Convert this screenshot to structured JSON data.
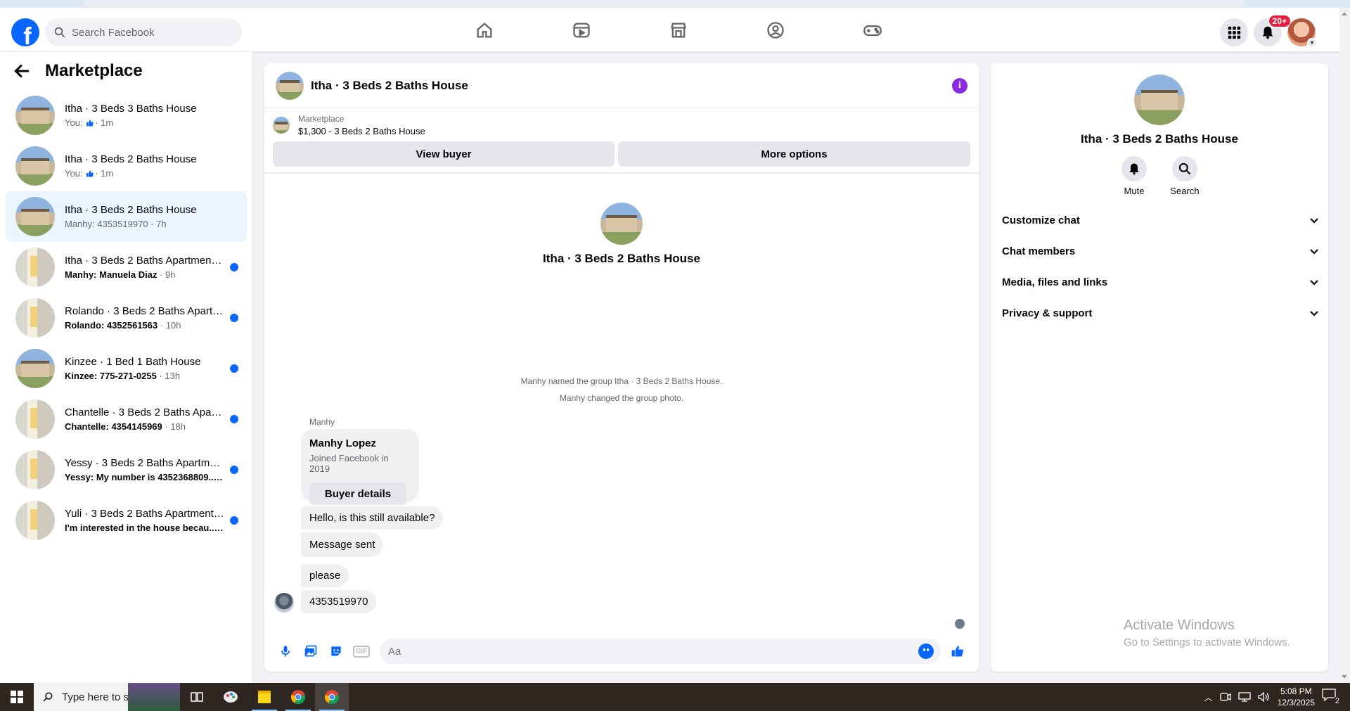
{
  "topbar": {
    "logo": "f",
    "search_placeholder": "Search Facebook",
    "nav_icons": [
      "home-icon",
      "video-icon",
      "marketplace-icon",
      "groups-icon",
      "gaming-icon"
    ],
    "notification_badge": "20+"
  },
  "sidebar": {
    "title": "Marketplace",
    "conversations": [
      {
        "title": "Itha · 3 Beds 3 Baths House",
        "prefix": "You:",
        "like": true,
        "time": "· 1m",
        "thumb": "house",
        "unread": false,
        "active": false
      },
      {
        "title": "Itha · 3 Beds 2 Baths House",
        "prefix": "You:",
        "like": true,
        "time": "· 1m",
        "thumb": "house",
        "unread": false,
        "active": false
      },
      {
        "title": "Itha · 3 Beds 2 Baths House",
        "prefix": "Manhy: 4353519970",
        "like": false,
        "time": " · 7h",
        "thumb": "house",
        "unread": false,
        "active": true
      },
      {
        "title": "Itha · 3 Beds 2 Baths Apartment/...",
        "prefix": "Manhy: Manuela Diaz",
        "like": false,
        "time": " · 9h",
        "thumb": "room",
        "unread": true,
        "active": false
      },
      {
        "title": "Rolando · 3 Beds 2 Baths Apartm...",
        "prefix": "Rolando: 4352561563",
        "like": false,
        "time": " · 10h",
        "thumb": "room",
        "unread": true,
        "active": false
      },
      {
        "title": "Kinzee · 1 Bed 1 Bath House",
        "prefix": "Kinzee: 775-271-0255",
        "like": false,
        "time": " · 13h",
        "thumb": "house",
        "unread": true,
        "active": false
      },
      {
        "title": "Chantelle · 3 Beds 2 Baths Apart...",
        "prefix": "Chantelle: 4354145969",
        "like": false,
        "time": " · 18h",
        "thumb": "room",
        "unread": true,
        "active": false
      },
      {
        "title": "Yessy · 3 Beds 2 Baths Apartmen...",
        "prefix": "Yessy: My number is 4352368809...",
        "like": false,
        "time": " · 20h",
        "thumb": "room",
        "unread": true,
        "active": false
      },
      {
        "title": "Yuli · 3 Beds 2 Baths Apartment/...",
        "prefix": "I'm interested in the house becau...",
        "like": false,
        "time": " · 21h",
        "thumb": "room",
        "unread": true,
        "active": false
      }
    ]
  },
  "chat": {
    "header_title": "Itha · 3 Beds 2 Baths House",
    "info_icon": "i",
    "listing_label": "Marketplace",
    "listing_value": "$1,300 - 3 Beds 2 Baths House",
    "view_buyer": "View buyer",
    "more_options": "More options",
    "group_name": "Itha · 3 Beds 2 Baths House",
    "system_messages": [
      "Manhy named the group Itha · 3 Beds 2 Baths House.",
      "Manhy changed the group photo."
    ],
    "sender": "Manhy",
    "buyer_card": {
      "name": "Manhy Lopez",
      "joined": "Joined Facebook in 2019",
      "button": "Buyer details"
    },
    "messages": [
      "Hello, is this still available?",
      "Message sent",
      "please",
      "4353519970"
    ],
    "composer_placeholder": "Aa",
    "gif_label": "GIF"
  },
  "details": {
    "title": "Itha · 3 Beds 2 Baths House",
    "actions": [
      {
        "label": "Mute",
        "icon": "bell-icon"
      },
      {
        "label": "Search",
        "icon": "search-icon"
      }
    ],
    "sections": [
      "Customize chat",
      "Chat members",
      "Media, files and links",
      "Privacy & support"
    ],
    "watermark_title": "Activate Windows",
    "watermark_sub": "Go to Settings to activate Windows."
  },
  "taskbar": {
    "search_placeholder": "Type here to search",
    "time": "5:08 PM",
    "date": "12/3/2025",
    "notification_count": "2"
  },
  "colors": {
    "accent": "#0866ff",
    "active_row": "#ebf5ff",
    "badge": "#e41e3f"
  }
}
